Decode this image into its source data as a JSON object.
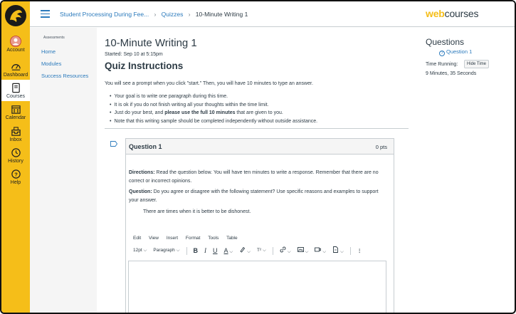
{
  "global_nav": {
    "items": [
      {
        "label": "Account",
        "icon": "account-icon"
      },
      {
        "label": "Dashboard",
        "icon": "dashboard-icon"
      },
      {
        "label": "Courses",
        "icon": "courses-icon",
        "active": true
      },
      {
        "label": "Calendar",
        "icon": "calendar-icon"
      },
      {
        "label": "Inbox",
        "icon": "inbox-icon"
      },
      {
        "label": "History",
        "icon": "history-icon"
      },
      {
        "label": "Help",
        "icon": "help-icon"
      }
    ],
    "color": "#f5be19"
  },
  "header": {
    "breadcrumb": [
      "Student Processing During Fee...",
      "Quizzes",
      "10-Minute Writing 1"
    ],
    "brand_web": "web",
    "brand_courses": "courses"
  },
  "course_nav": {
    "subtitle": "Assessments",
    "items": [
      "Home",
      "Modules",
      "Success Resources"
    ]
  },
  "main": {
    "title": "10-Minute Writing 1",
    "started": "Started: Sep 10 at 5:15pm",
    "instructions_heading": "Quiz Instructions",
    "intro": "You will see a prompt when you click \"start.\" Then, you will have 10 minutes to type an answer.",
    "bullets": [
      "Your goal is to write one paragraph during this time.",
      "It is ok if you do not finish writing all your thoughts within the time limit.",
      "Note that this writing sample should be completed independently without outside assistance."
    ],
    "bullet_3_prefix": "Just do your best, and ",
    "bullet_3_bold": "please use the full 10 minutes",
    "bullet_3_suffix": " that are given to you."
  },
  "question": {
    "title": "Question 1",
    "points": "0 pts",
    "directions_label": "Directions:",
    "directions_text": " Read the question below. You will have ten minutes to write a response. Remember that there are no correct or incorrect opinions.",
    "question_label": "Question:",
    "question_text": " Do you agree or disagree with the following statement? Use specific reasons and examples to support your answer.",
    "statement": "There are times when it is better to be dishonest."
  },
  "editor": {
    "menu": [
      "Edit",
      "View",
      "Insert",
      "Format",
      "Tools",
      "Table"
    ],
    "font_size": "12pt",
    "block": "Paragraph",
    "bold": "B",
    "italic": "I",
    "underline": "U",
    "font_color": "A",
    "superscript": "T²"
  },
  "sidebar": {
    "heading": "Questions",
    "question_link": "Question 1",
    "time_label": "Time Running:",
    "hide_button": "Hide Time",
    "time_value": "9 Minutes, 35 Seconds"
  }
}
